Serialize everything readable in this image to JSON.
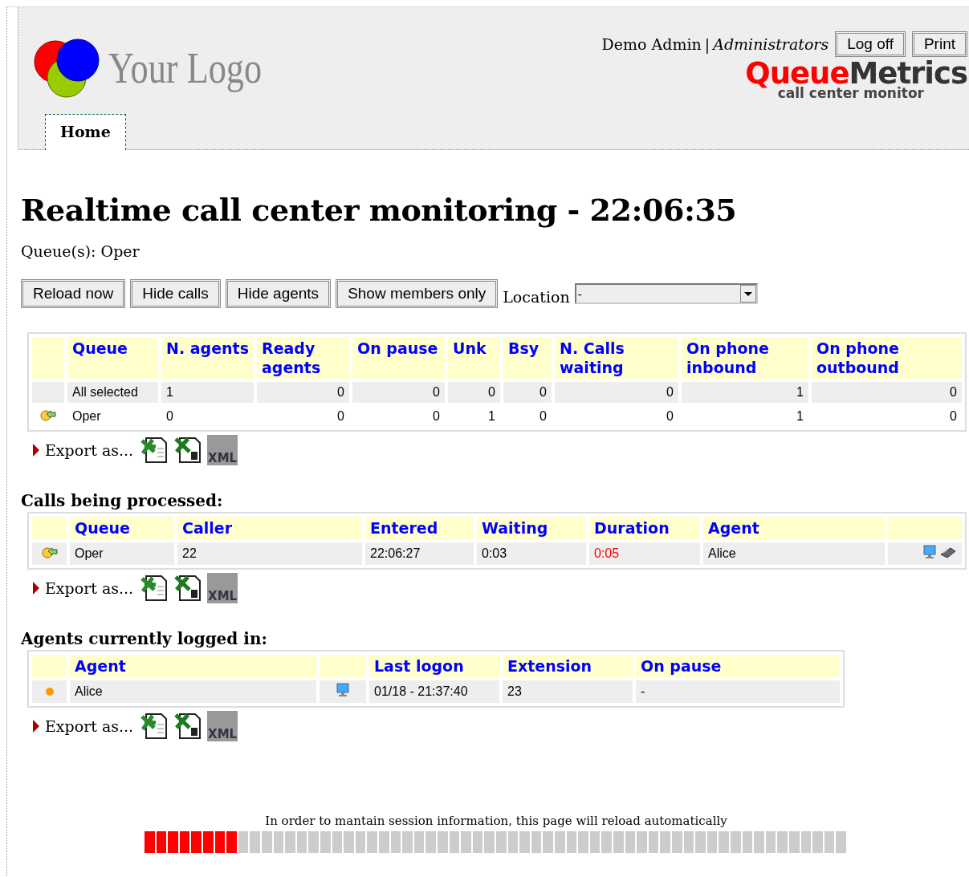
{
  "header": {
    "logo_text": "Your Logo",
    "user": "Demo Admin",
    "separator": "|",
    "role": "Administrators",
    "buttons": [
      "Log off",
      "Print"
    ],
    "brand_first": "Queue",
    "brand_second": "Metrics",
    "brand_tagline": "call center monitor"
  },
  "tabs": [
    {
      "label": "Home",
      "selected": true
    }
  ],
  "title": "Realtime call center monitoring - 22:06:35",
  "queues_line": "Queue(s): Oper",
  "toolbar": {
    "buttons": [
      "Reload now",
      "Hide calls",
      "Hide agents",
      "Show members only"
    ],
    "location_label": "Location",
    "location_value": "-"
  },
  "queue_table": {
    "columns": [
      "Queue",
      "N. agents",
      "Ready agents",
      "On pause",
      "Unk",
      "Bsy",
      "N. Calls waiting",
      "On phone inbound",
      "On phone outbound"
    ],
    "rows": [
      {
        "kind": "total",
        "cells": [
          "All selected",
          "1",
          "0",
          "0",
          "0",
          "0",
          "0",
          "1",
          "0"
        ]
      },
      {
        "kind": "queue",
        "cells": [
          "Oper",
          "0",
          "0",
          "0",
          "1",
          "0",
          "0",
          "1",
          "0"
        ]
      }
    ]
  },
  "exports": [
    {
      "label": "Export as...",
      "xml_text": "XML"
    },
    {
      "label": "Export as...",
      "xml_text": "XML"
    },
    {
      "label": "Export as...",
      "xml_text": "XML"
    }
  ],
  "calls_section": {
    "title": "Calls being processed:",
    "columns": [
      "Queue",
      "Caller",
      "Entered",
      "Waiting",
      "Duration",
      "Agent"
    ],
    "rows": [
      {
        "kind": "queue",
        "queue": "Oper",
        "caller": "22",
        "entered": "22:06:27",
        "waiting": "0:03",
        "duration": "0:05",
        "duration_alert": true,
        "agent": "Alice"
      }
    ]
  },
  "agents_section": {
    "title": "Agents currently logged in:",
    "columns": [
      "Agent",
      "Last logon",
      "Extension",
      "On pause"
    ],
    "rows": [
      {
        "color": "#ff9900",
        "agent": "Alice",
        "last_logon": "01/18 - 21:37:40",
        "extension": "23",
        "on_pause": "-"
      }
    ]
  },
  "reload": {
    "message": "In order to mantain session information, this page will reload automatically",
    "level": 0.133
  }
}
